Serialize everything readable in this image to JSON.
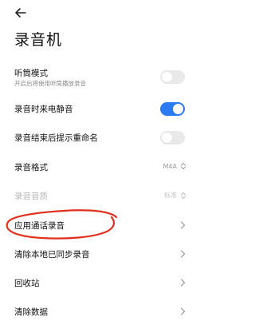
{
  "header": {
    "back_icon": "arrow-left-icon",
    "title": "录音机"
  },
  "settings": {
    "earpiece_mode": {
      "label": "听筒模式",
      "sublabel": "开启后将使用听筒播放录音",
      "enabled": false
    },
    "mute_on_call": {
      "label": "录音时来电静音",
      "enabled": true
    },
    "rename_prompt": {
      "label": "录音结束后提示重命名",
      "enabled": false
    },
    "format": {
      "label": "录音格式",
      "value": "M4A"
    },
    "quality": {
      "label": "录音音质",
      "value": "标准",
      "disabled": true
    },
    "call_recording": {
      "label": "应用通话录音"
    },
    "clear_synced": {
      "label": "清除本地已同步录音"
    },
    "recycle_bin": {
      "label": "回收站"
    },
    "clear_data": {
      "label": "清除数据"
    }
  },
  "colors": {
    "toggle_on": "#2a7bf4",
    "toggle_off": "#e9e9ea",
    "annotation": "#e0301e"
  }
}
